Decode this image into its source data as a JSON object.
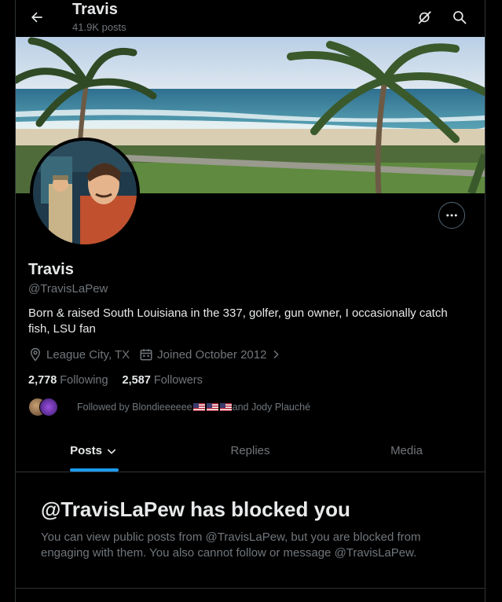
{
  "header": {
    "title": "Travis",
    "posts_count": "41.9K posts",
    "back_icon": "arrow-left-icon",
    "grok_icon": "grok-icon",
    "search_icon": "search-icon"
  },
  "profile": {
    "display_name": "Travis",
    "handle": "@TravisLaPew",
    "bio": "Born & raised South Louisiana in the 337, golfer, gun owner, I occasionally catch fish, LSU fan",
    "location": "League City, TX",
    "joined": "Joined October 2012",
    "following_count": "2,778",
    "following_label": "Following",
    "followers_count": "2,587",
    "followers_label": "Followers",
    "followed_by_prefix": "Followed by Blondieeeeee",
    "followed_by_suffix": " and Jody Plauché"
  },
  "tabs": [
    {
      "label": "Posts",
      "active": true
    },
    {
      "label": "Replies",
      "active": false
    },
    {
      "label": "Media",
      "active": false
    }
  ],
  "blocked": {
    "title": "@TravisLaPew has blocked you",
    "message": "You can view public posts from @TravisLaPew, but you are blocked from engaging with them. You also cannot follow or message @TravisLaPew."
  },
  "colors": {
    "accent": "#1d9bf0",
    "muted": "#71767b",
    "text": "#e7e9ea",
    "border": "#2f3336"
  }
}
